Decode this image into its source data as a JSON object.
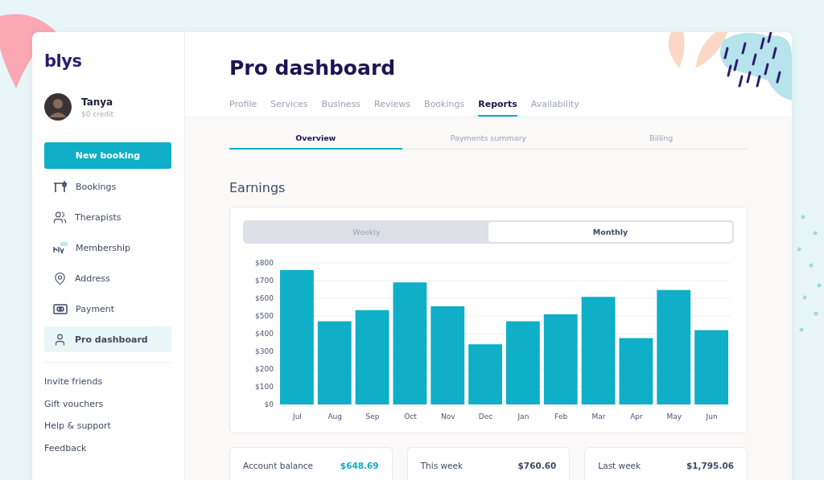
{
  "brand": "blys",
  "user": {
    "name": "Tanya",
    "credit": "$0 credit"
  },
  "sidebar": {
    "primary_button": "New booking",
    "items": [
      {
        "label": "Bookings",
        "kind": "bookings",
        "selected": false
      },
      {
        "label": "Therapists",
        "kind": "therapists",
        "selected": false
      },
      {
        "label": "Membership",
        "kind": "membership",
        "selected": false
      },
      {
        "label": "Address",
        "kind": "address",
        "selected": false
      },
      {
        "label": "Payment",
        "kind": "payment",
        "selected": false
      },
      {
        "label": "Pro dashboard",
        "kind": "pro",
        "selected": true
      }
    ],
    "links": [
      "Invite friends",
      "Gift vouchers",
      "Help & support",
      "Feedback"
    ]
  },
  "page_title": "Pro dashboard",
  "tabs": [
    {
      "label": "Profile",
      "selected": false
    },
    {
      "label": "Services",
      "selected": false
    },
    {
      "label": "Business",
      "selected": false
    },
    {
      "label": "Reviews",
      "selected": false
    },
    {
      "label": "Bookings",
      "selected": false
    },
    {
      "label": "Reports",
      "selected": true
    },
    {
      "label": "Availability",
      "selected": false
    }
  ],
  "subtabs": [
    {
      "label": "Overview",
      "selected": true
    },
    {
      "label": "Payments summary",
      "selected": false
    },
    {
      "label": "Billing",
      "selected": false
    }
  ],
  "earnings": {
    "title": "Earnings",
    "period_toggle": [
      {
        "label": "Weekly",
        "selected": false
      },
      {
        "label": "Monthly",
        "selected": true
      }
    ],
    "chart_data": {
      "type": "bar",
      "categories": [
        "Jul",
        "Aug",
        "Sep",
        "Oct",
        "Nov",
        "Dec",
        "Jan",
        "Feb",
        "Mar",
        "Apr",
        "May",
        "Jun"
      ],
      "grid": true,
      "series": [
        {
          "color": "#0fafc8",
          "values": [
            760,
            470,
            533,
            690,
            555,
            340,
            470,
            510,
            608,
            375,
            647,
            420
          ]
        }
      ],
      "ylim": [
        0,
        800
      ],
      "yticks": [
        {
          "value": 0,
          "label": "$0"
        },
        {
          "value": 100,
          "label": "$100"
        },
        {
          "value": 200,
          "label": "$200"
        },
        {
          "value": 300,
          "label": "$300"
        },
        {
          "value": 400,
          "label": "$400"
        },
        {
          "value": 500,
          "label": "$500"
        },
        {
          "value": 600,
          "label": "$600"
        },
        {
          "value": 700,
          "label": "$700"
        },
        {
          "value": 800,
          "label": "$800"
        }
      ]
    }
  },
  "summary_cards": [
    {
      "label": "Account balance",
      "value": "$648.69",
      "highlight": true
    },
    {
      "label": "This week",
      "value": "$760.60",
      "highlight": false
    },
    {
      "label": "Last week",
      "value": "$1,795.06",
      "highlight": false
    }
  ]
}
